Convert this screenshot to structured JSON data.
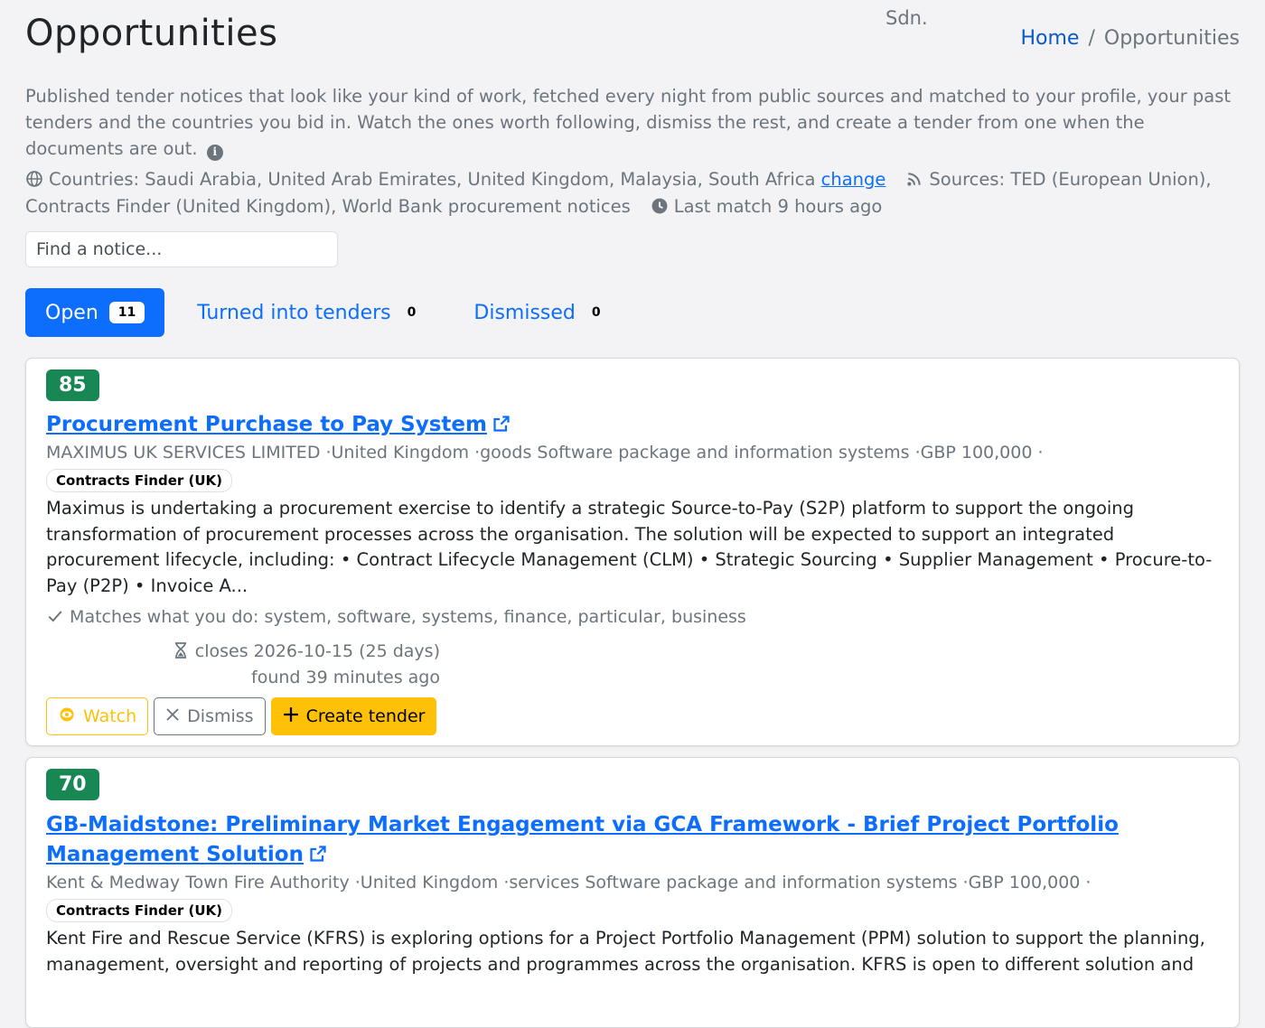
{
  "header": {
    "title": "Opportunities",
    "company_fragment": "Sdn.",
    "breadcrumb": {
      "home": "Home",
      "current": "Opportunities",
      "separator": "/"
    }
  },
  "intro": "Published tender notices that look like your kind of work, fetched every night from public sources and matched to your profile, your past tenders and the countries you bid in. Watch the ones worth following, dismiss the rest, and create a tender from one when the documents are out.",
  "meta": {
    "countries": "Countries: Saudi Arabia, United Arab Emirates, United Kingdom, Malaysia, South Africa",
    "change_link": "change",
    "sources": "Sources: TED (European Union), Contracts Finder (United Kingdom), World Bank procurement notices",
    "last_match": "Last match 9 hours ago"
  },
  "search": {
    "placeholder": "Find a notice..."
  },
  "tabs": [
    {
      "label": "Open",
      "count": "11"
    },
    {
      "label": "Turned into tenders",
      "count": "0"
    },
    {
      "label": "Dismissed",
      "count": "0"
    }
  ],
  "notices": [
    {
      "score": "85",
      "title": "Procurement Purchase to Pay System",
      "buyer_line": "MAXIMUS UK SERVICES LIMITED ·United Kingdom ·goods Software package and information systems ·GBP 100,000 ·",
      "source": "Contracts Finder (UK)",
      "description": "Maximus is undertaking a procurement exercise to identify a strategic Source-to-Pay (S2P) platform to support the ongoing transformation of procurement processes across the organisation. The solution will be expected to support an integrated procurement lifecycle, including: • Contract Lifecycle Management (CLM) • Strategic Sourcing • Supplier Management • Procure-to-Pay (P2P) • Invoice A...",
      "matches": "Matches what you do: system, software, systems, finance, particular, business",
      "closes": "closes 2026-10-15 (25 days)",
      "found": "found 39 minutes ago",
      "actions": {
        "watch": "Watch",
        "dismiss": "Dismiss",
        "create": "Create tender"
      }
    },
    {
      "score": "70",
      "title": "GB-Maidstone: Preliminary Market Engagement via GCA Framework - Brief Project Portfolio Management Solution",
      "buyer_line": "Kent & Medway Town Fire Authority ·United Kingdom ·services Software package and information systems ·GBP 100,000 ·",
      "source": "Contracts Finder (UK)",
      "description": "Kent Fire and Rescue Service (KFRS) is exploring options for a Project Portfolio Management (PPM) solution to support the planning, management, oversight and reporting of projects and programmes across the organisation. KFRS is open to different solution and"
    }
  ],
  "colors": {
    "primary": "#0d6efd",
    "score_green": "#198754",
    "warning": "#ffc107",
    "muted": "#6c757d",
    "background": "#f3f3f5"
  },
  "icons": [
    "info-icon",
    "globe-icon",
    "rss-icon",
    "clock-icon",
    "external-link-icon",
    "check-icon",
    "hourglass-icon",
    "eye-icon",
    "x-icon",
    "plus-icon"
  ]
}
